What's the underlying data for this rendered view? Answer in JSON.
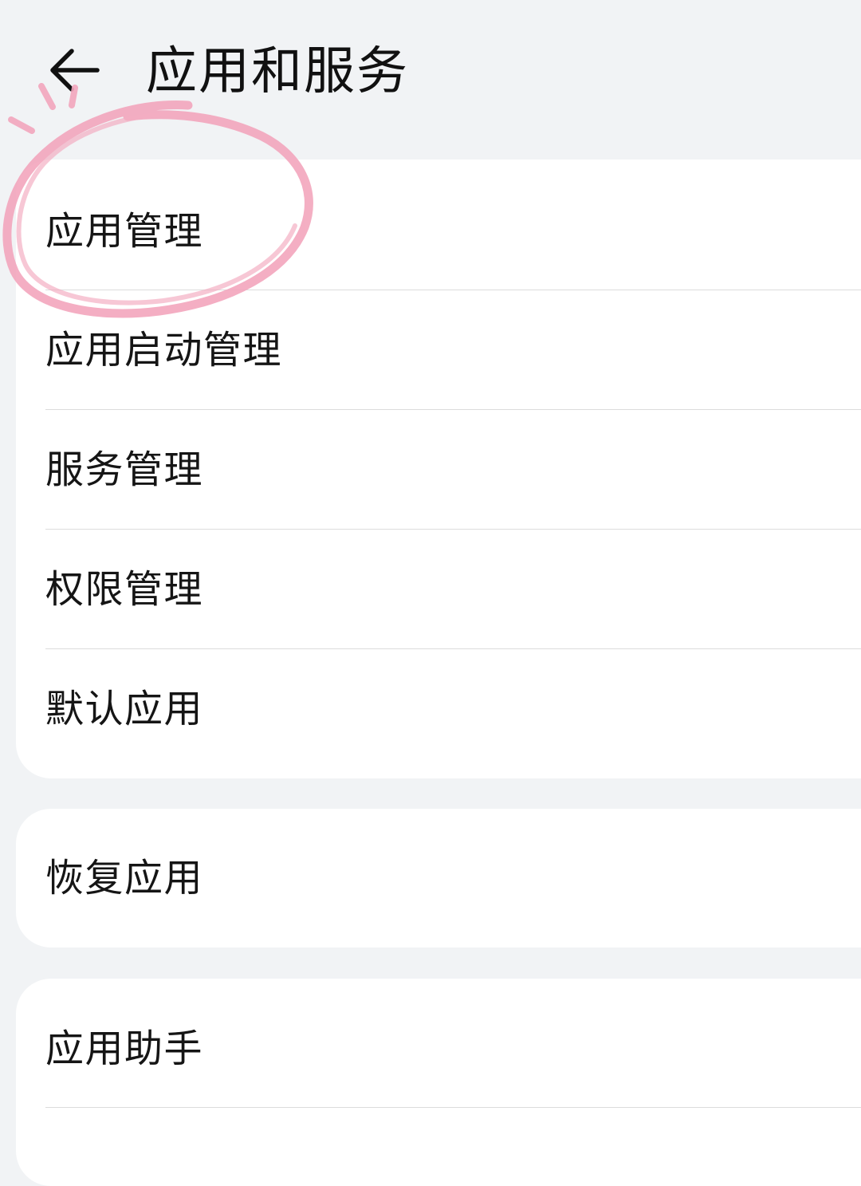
{
  "header": {
    "title": "应用和服务",
    "back_icon": "arrow-left-icon"
  },
  "groups": [
    {
      "items": [
        {
          "label": "应用管理"
        },
        {
          "label": "应用启动管理"
        },
        {
          "label": "服务管理"
        },
        {
          "label": "权限管理"
        },
        {
          "label": "默认应用"
        }
      ]
    },
    {
      "items": [
        {
          "label": "恢复应用"
        }
      ]
    },
    {
      "items": [
        {
          "label": "应用助手"
        }
      ]
    }
  ],
  "colors": {
    "background": "#f1f3f5",
    "card": "#ffffff",
    "annotation": "#f3a6bd"
  }
}
